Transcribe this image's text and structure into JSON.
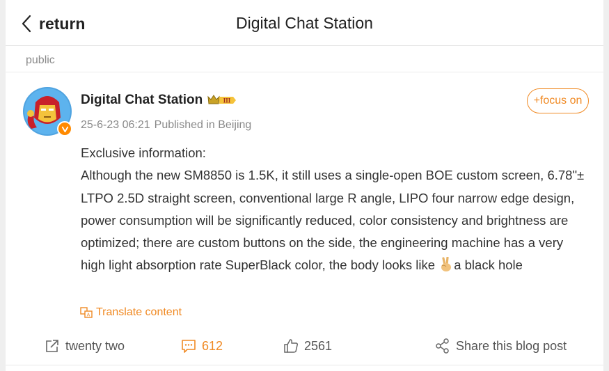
{
  "header": {
    "back_label": "return",
    "title": "Digital Chat Station"
  },
  "visibility": "public",
  "post": {
    "author": "Digital Chat Station",
    "rank_badge": "III",
    "follow_label": "+focus on",
    "date": "25-6-23 06:21",
    "location": "Published in Beijing",
    "body_line1": "Exclusive information:",
    "body_main": "Although the new SM8850 is 1.5K, it still uses a single-open BOE custom screen, 6.78\"± LTPO 2.5D straight screen, conventional large R angle, LIPO four narrow edge design, power consumption will be significantly reduced, color consistency and brightness are optimized; there are custom buttons on the side, the engineering machine has a very high light absorption rate SuperBlack color, the body looks like",
    "body_tail": "a black hole",
    "translate_label": "Translate content"
  },
  "actions": {
    "forward_count": "twenty two",
    "comment_count": "612",
    "like_count": "2561",
    "share_label": "Share this blog post"
  },
  "colors": {
    "accent": "#f08a24",
    "text": "#333333",
    "muted": "#8a8a8a"
  }
}
